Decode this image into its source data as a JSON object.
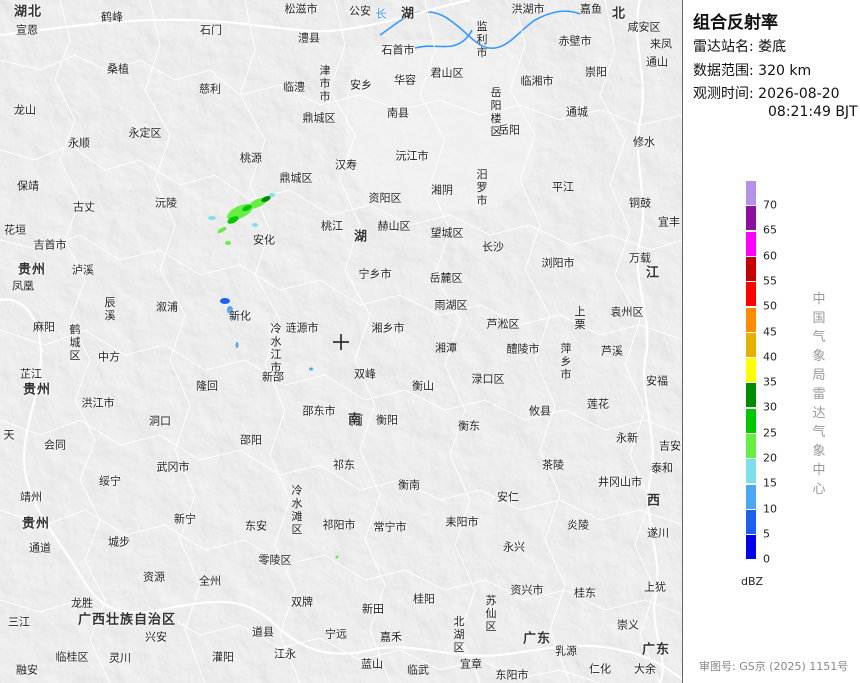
{
  "panel": {
    "title": "组合反射率",
    "station_label": "雷达站名:",
    "station_value": "娄底",
    "range_label": "数据范围:",
    "range_value": "320 km",
    "time_label": "观测时间:",
    "time_date": "2026-08-20",
    "time_clock": "08:21:49 BJT",
    "scale_unit": "dBZ",
    "agency": "中国气象局雷达气象中心",
    "review": "审图号: GS京 (2025) 1151号"
  },
  "colors": {
    "map_background": "#e9e9e9",
    "boundary": "#ffffff",
    "river": "#3399ff"
  },
  "legend": [
    {
      "value": "70",
      "color": "#b591e8"
    },
    {
      "value": "65",
      "color": "#8e0ea0"
    },
    {
      "value": "60",
      "color": "#ff00ff"
    },
    {
      "value": "55",
      "color": "#c80000"
    },
    {
      "value": "50",
      "color": "#ff0000"
    },
    {
      "value": "45",
      "color": "#ff8c00"
    },
    {
      "value": "40",
      "color": "#e6b000"
    },
    {
      "value": "35",
      "color": "#ffff00"
    },
    {
      "value": "30",
      "color": "#008c00"
    },
    {
      "value": "25",
      "color": "#00c800"
    },
    {
      "value": "20",
      "color": "#66ee44"
    },
    {
      "value": "15",
      "color": "#7ee0e8"
    },
    {
      "value": "10",
      "color": "#4aa8f0"
    },
    {
      "value": "5",
      "color": "#1e5ef0"
    },
    {
      "value": "0",
      "color": "#0000ee"
    }
  ],
  "map_labels": [
    "湖北",
    "鹤峰",
    "松滋市",
    "公安",
    "长",
    "湖",
    "洪湖市",
    "嘉鱼",
    "北",
    "咸安区",
    "宣恩",
    "石门",
    "澧县",
    "石首市",
    "监利市",
    "赤壁市",
    "来凤",
    "桑植",
    "津市市",
    "华容",
    "君山区",
    "临湘市",
    "崇阳",
    "慈利",
    "临澧",
    "安乡",
    "岳阳楼区",
    "通山",
    "龙山",
    "永定区",
    "鼎城区",
    "南县",
    "岳阳",
    "通城",
    "修水",
    "永顺",
    "桃源",
    "汉寿",
    "沅江市",
    "汨罗市",
    "保靖",
    "鼎城区",
    "资阳区",
    "湘阴",
    "平江",
    "铜鼓",
    "古丈",
    "沅陵",
    "桃江",
    "赫山区",
    "望城区",
    "宜丰",
    "花垣",
    "吉首市",
    "安化",
    "长沙",
    "万载",
    "贵州",
    "泸溪",
    "宁乡市",
    "岳麓区",
    "浏阳市",
    "凤凰",
    "辰溪",
    "溆浦",
    "雨湖区",
    "芦淞区",
    "上栗",
    "袁州区",
    "麻阳",
    "鹤城区",
    "涟源市",
    "湘乡市",
    "萍乡市",
    "中方",
    "冷水江市",
    "湘潭",
    "醴陵市",
    "芦溪",
    "新化",
    "新邵",
    "双峰",
    "渌口区",
    "安福",
    "芷江",
    "隆回",
    "衡山",
    "攸县",
    "莲花",
    "贵州",
    "洪江市",
    "邵东市",
    "衡阳",
    "天",
    "洞口",
    "南",
    "衡东",
    "永新",
    "吉安",
    "会同",
    "邵阳",
    "祁东",
    "茶陵",
    "武冈市",
    "衡南",
    "井冈山市",
    "泰和",
    "靖州",
    "绥宁",
    "新宁",
    "安仁",
    "遂川",
    "东安",
    "祁阳市",
    "常宁市",
    "耒阳市",
    "炎陵",
    "贵州",
    "通道",
    "城步",
    "零陵区",
    "永兴",
    "资兴市",
    "上犹",
    "资源",
    "全州",
    "双牌",
    "新田",
    "桂阳",
    "苏仙区",
    "桂东",
    "三江",
    "龙胜",
    "宁远",
    "嘉禾",
    "北湖区",
    "崇义",
    "广西壮族自治区",
    "兴安",
    "道县",
    "广东",
    "融安",
    "临桂区",
    "灵川",
    "灌阳",
    "江永",
    "蓝山",
    "临武",
    "宜章",
    "乳源",
    "仁化",
    "大余",
    "广东",
    "东阳市",
    "江",
    "西",
    "冷水滩区",
    "湖",
    "南"
  ],
  "radar_echoes": [
    {
      "value": "20",
      "description": "green echoes near 安化"
    },
    {
      "value": "5",
      "description": "blue echoes near 新化"
    }
  ]
}
